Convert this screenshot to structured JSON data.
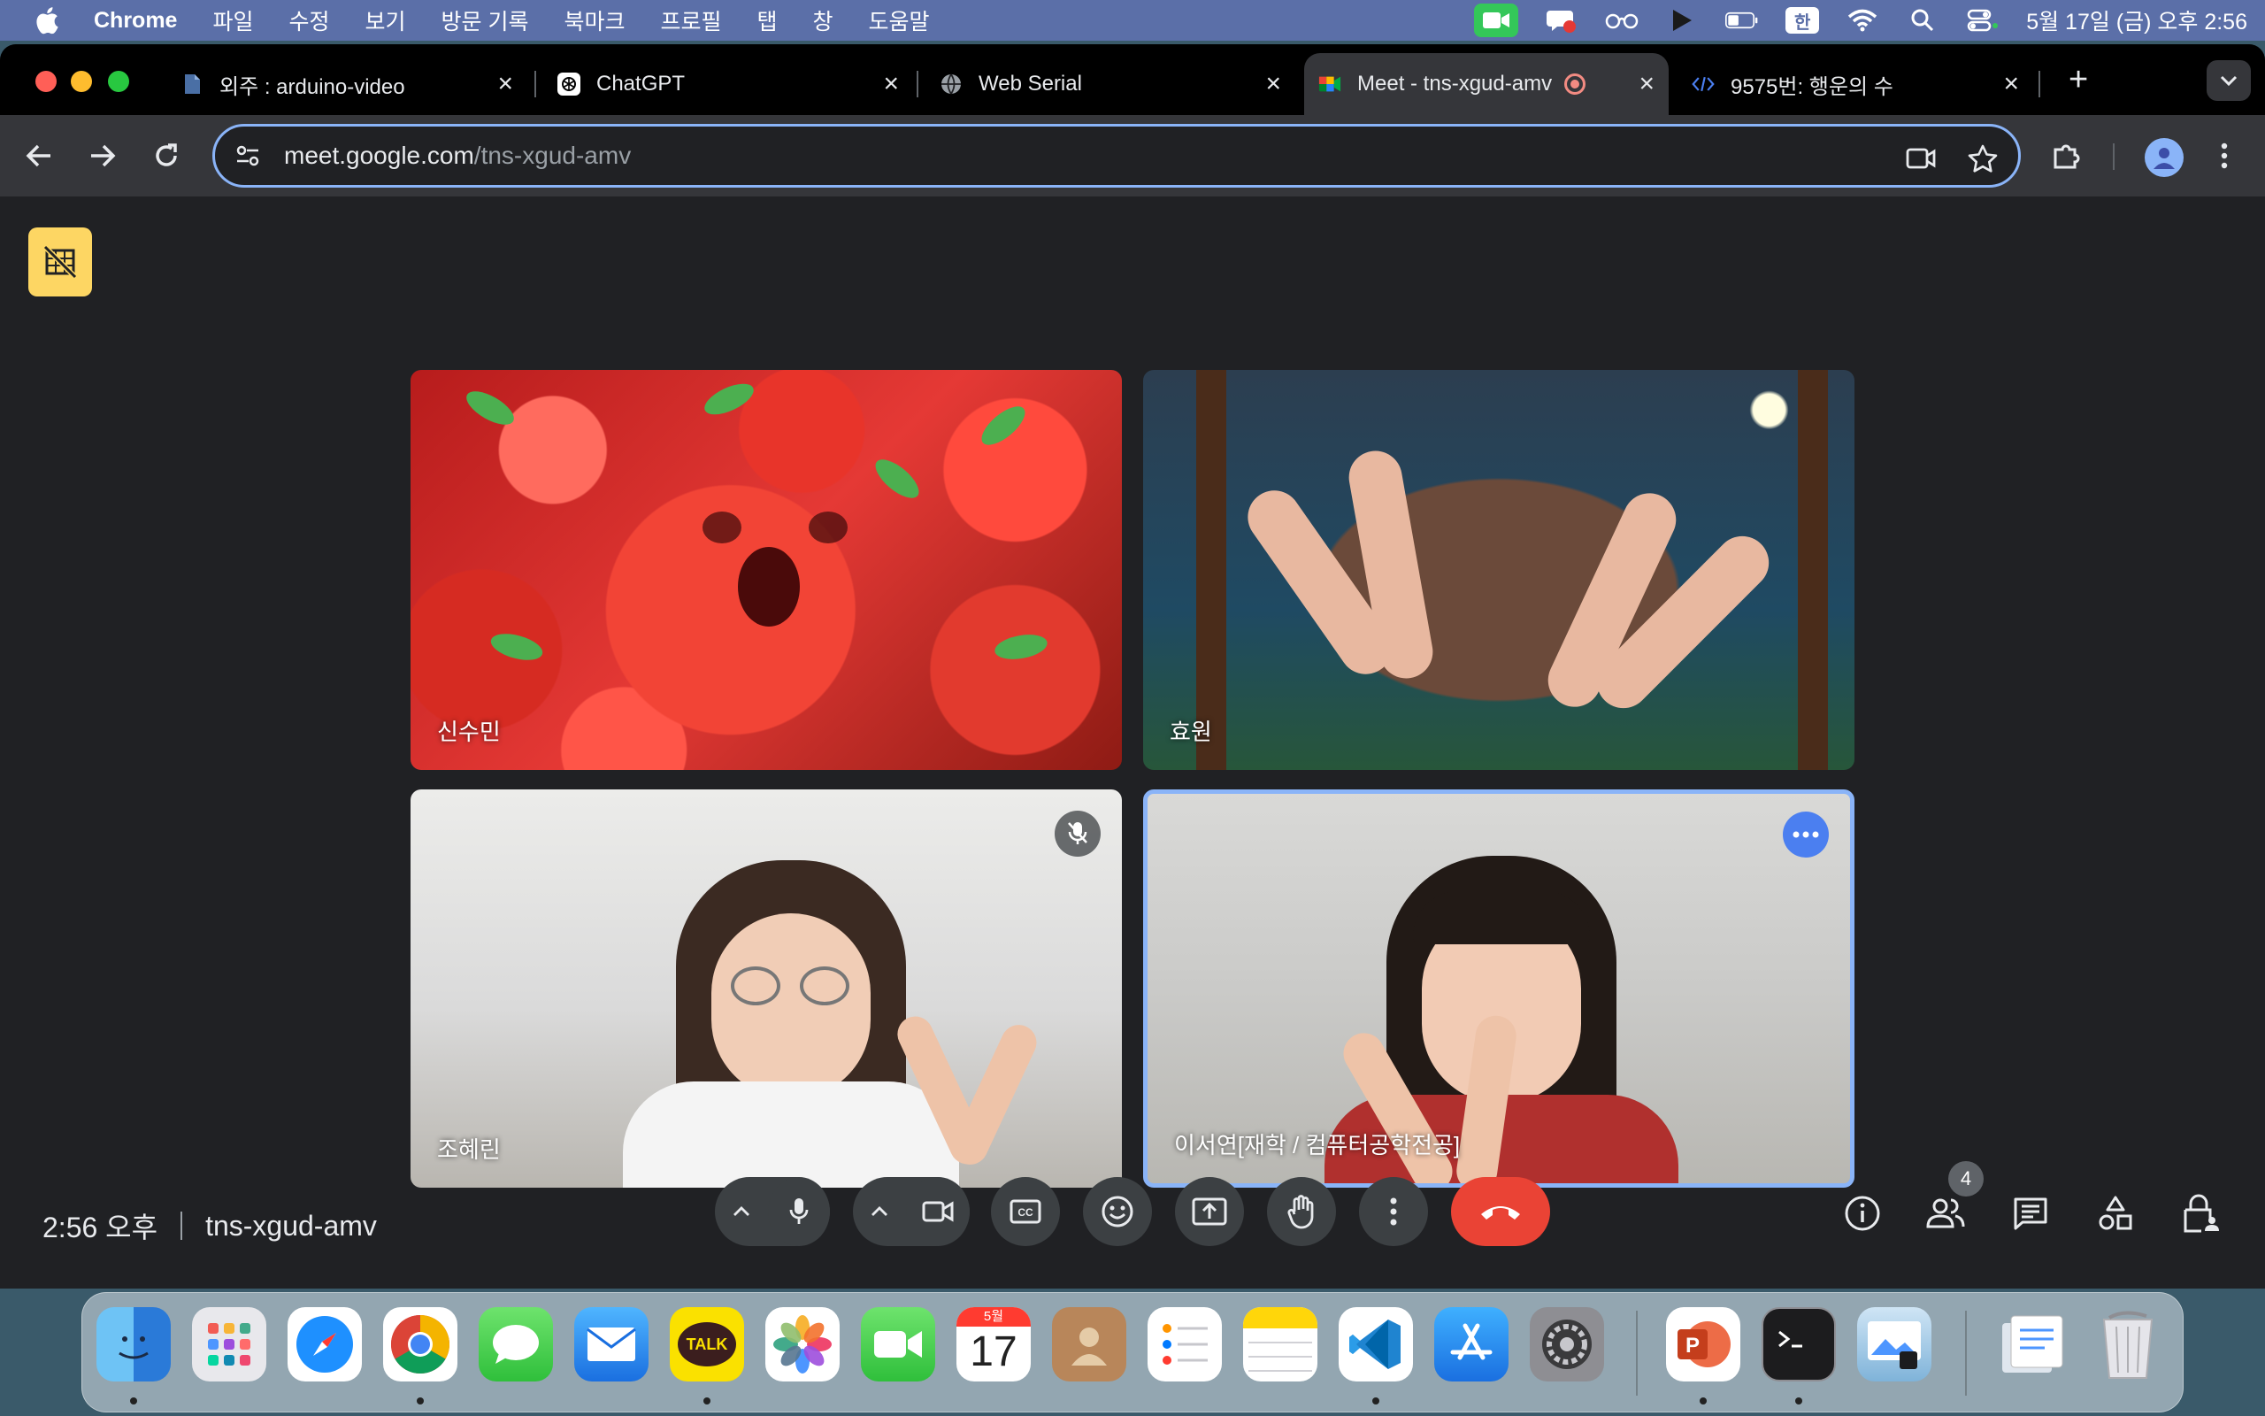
{
  "menubar": {
    "app_name": "Chrome",
    "menus": [
      "파일",
      "수정",
      "보기",
      "방문 기록",
      "북마크",
      "프로필",
      "탭",
      "창",
      "도움말"
    ],
    "input_source": "한",
    "clock": "5월 17일 (금) 오후 2:56"
  },
  "tabs": [
    {
      "title": "외주 : arduino-video",
      "icon": "doc-icon"
    },
    {
      "title": "ChatGPT",
      "icon": "chatgpt-icon"
    },
    {
      "title": "Web Serial",
      "icon": "globe-icon"
    },
    {
      "title": "Meet - tns-xgud-amv",
      "icon": "meet-icon",
      "active": true,
      "recording": true
    },
    {
      "title": "9575번: 행운의 수",
      "icon": "code-icon"
    }
  ],
  "omnibox": {
    "host": "meet.google.com",
    "path": "/tns-xgud-amv"
  },
  "participants": [
    {
      "name": "신수민",
      "muted": false
    },
    {
      "name": "효원",
      "muted": false
    },
    {
      "name": "조혜린",
      "muted": true
    },
    {
      "name": "이서연[재학 / 컴퓨터공학전공]",
      "muted": false,
      "speaking": true
    }
  ],
  "meeting": {
    "time": "2:56 오후",
    "code": "tns-xgud-amv",
    "people_count": "4"
  },
  "dock": {
    "calendar_month": "5월",
    "calendar_day": "17",
    "kakao_label": "TALK"
  },
  "colors": {
    "menubar_bg": "#5b6fa8",
    "accent_blue": "#8ab4f8",
    "end_call_red": "#ea4335",
    "hide_button_yellow": "#fdd663"
  }
}
